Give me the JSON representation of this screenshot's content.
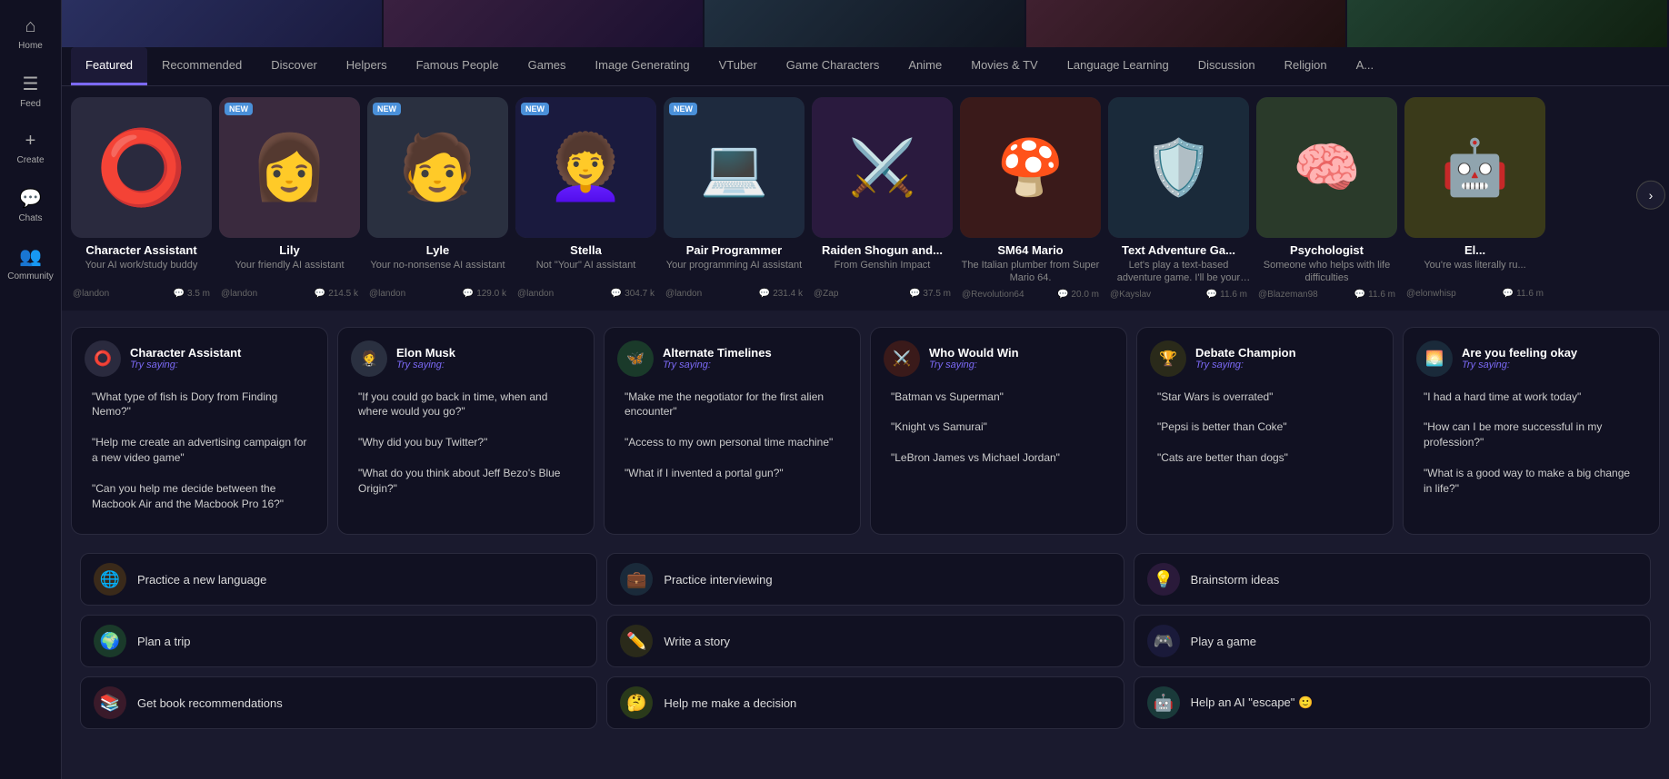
{
  "sidebar": {
    "items": [
      {
        "id": "home",
        "icon": "⌂",
        "label": "Home"
      },
      {
        "id": "feed",
        "icon": "☰",
        "label": "Feed"
      },
      {
        "id": "create",
        "icon": "+",
        "label": "Create"
      },
      {
        "id": "chats",
        "icon": "💬",
        "label": "Chats"
      },
      {
        "id": "community",
        "icon": "👥",
        "label": "Community"
      }
    ]
  },
  "tabs": [
    {
      "id": "featured",
      "label": "Featured",
      "active": true
    },
    {
      "id": "recommended",
      "label": "Recommended"
    },
    {
      "id": "discover",
      "label": "Discover"
    },
    {
      "id": "helpers",
      "label": "Helpers"
    },
    {
      "id": "famous-people",
      "label": "Famous People"
    },
    {
      "id": "games",
      "label": "Games"
    },
    {
      "id": "image-generating",
      "label": "Image Generating"
    },
    {
      "id": "vtuber",
      "label": "VTuber"
    },
    {
      "id": "game-characters",
      "label": "Game Characters"
    },
    {
      "id": "anime",
      "label": "Anime"
    },
    {
      "id": "movies-tv",
      "label": "Movies & TV"
    },
    {
      "id": "language-learning",
      "label": "Language Learning"
    },
    {
      "id": "discussion",
      "label": "Discussion"
    },
    {
      "id": "religion",
      "label": "Religion"
    },
    {
      "id": "more",
      "label": "A..."
    }
  ],
  "characters": [
    {
      "id": "char-assistant",
      "name": "Character Assistant",
      "desc": "Your AI work/study buddy",
      "author": "@landon",
      "count": "3.5 m",
      "is_new": false,
      "bg": "#2a2a3e",
      "emoji": "⭕",
      "emoji_size": "80px",
      "color": "#fff"
    },
    {
      "id": "lily",
      "name": "Lily",
      "desc": "Your friendly AI assistant",
      "author": "@landon",
      "count": "214.5 k",
      "is_new": true,
      "bg": "#3a2a3e",
      "emoji": "👩",
      "emoji_size": "70px",
      "color": "#ffb6c1"
    },
    {
      "id": "lyle",
      "name": "Lyle",
      "desc": "Your no-nonsense AI assistant",
      "author": "@landon",
      "count": "129.0 k",
      "is_new": true,
      "bg": "#2a3040",
      "emoji": "🧑",
      "emoji_size": "70px",
      "color": "#add8e6"
    },
    {
      "id": "stella",
      "name": "Stella",
      "desc": "Not \"Your\" AI assistant",
      "author": "@landon",
      "count": "304.7 k",
      "is_new": true,
      "bg": "#1a1a3e",
      "emoji": "👩‍🦱",
      "emoji_size": "70px",
      "color": "#9b59b6"
    },
    {
      "id": "pair-programmer",
      "name": "Pair Programmer",
      "desc": "Your programming AI assistant",
      "author": "@landon",
      "count": "231.4 k",
      "is_new": true,
      "bg": "#1e2a3e",
      "emoji": "💻",
      "emoji_size": "60px",
      "color": "#74b9ff"
    },
    {
      "id": "raiden",
      "name": "Raiden Shogun and...",
      "desc": "From Genshin Impact",
      "author": "@Zap",
      "count": "37.5 m",
      "is_new": false,
      "bg": "#2a1a3e",
      "emoji": "⚔️",
      "emoji_size": "60px",
      "color": "#a29bfe"
    },
    {
      "id": "sm64mario",
      "name": "SM64 Mario",
      "desc": "The Italian plumber from Super Mario 64.",
      "author": "@Revolution64",
      "count": "20.0 m",
      "is_new": false,
      "bg": "#3a1a1a",
      "emoji": "🍄",
      "emoji_size": "60px",
      "color": "#e17055"
    },
    {
      "id": "text-adventure",
      "name": "Text Adventure Ga...",
      "desc": "Let's play a text-based adventure game. I'll be your guide. You are caug...",
      "author": "@Kayslav",
      "count": "11.6 m",
      "is_new": false,
      "bg": "#1a2a3a",
      "emoji": "🛡️",
      "emoji_size": "60px",
      "color": "#74b9ff"
    },
    {
      "id": "psychologist",
      "name": "Psychologist",
      "desc": "Someone who helps with life difficulties",
      "author": "@Blazeman98",
      "count": "11.6 m",
      "is_new": false,
      "bg": "#2a3a2a",
      "emoji": "🧠",
      "emoji_size": "60px",
      "color": "#55efc4"
    },
    {
      "id": "elonwhisp",
      "name": "El...",
      "desc": "You're was literally ru...",
      "author": "@elonwhisp",
      "count": "11.6 m",
      "is_new": false,
      "bg": "#3a3a1a",
      "emoji": "🤖",
      "emoji_size": "60px",
      "color": "#fdcb6e"
    }
  ],
  "try_cards": [
    {
      "id": "character-assistant",
      "name": "Character Assistant",
      "avatar_emoji": "⭕",
      "avatar_bg": "#2a2a3e",
      "prompts": [
        "\"What type of fish is Dory from Finding Nemo?\"",
        "\"Help me create an advertising campaign for a new video game\"",
        "\"Can you help me decide between the Macbook Air and the Macbook Pro 16?\""
      ]
    },
    {
      "id": "elon-musk",
      "name": "Elon Musk",
      "avatar_emoji": "🤵",
      "avatar_bg": "#2a3040",
      "prompts": [
        "\"If you could go back in time, when and where would you go?\"",
        "\"Why did you buy Twitter?\"",
        "\"What do you think about Jeff Bezo's Blue Origin?\""
      ]
    },
    {
      "id": "alternate-timelines",
      "name": "Alternate Timelines",
      "avatar_emoji": "🦋",
      "avatar_bg": "#1a3a2a",
      "prompts": [
        "\"Make me the negotiator for the first alien encounter\"",
        "\"Access to my own personal time machine\"",
        "\"What if I invented a portal gun?\""
      ]
    },
    {
      "id": "who-would-win",
      "name": "Who Would Win",
      "avatar_emoji": "⚔️",
      "avatar_bg": "#3a1a1a",
      "prompts": [
        "\"Batman vs Superman\"",
        "\"Knight vs Samurai\"",
        "\"LeBron James vs Michael Jordan\""
      ]
    },
    {
      "id": "debate-champion",
      "name": "Debate Champion",
      "avatar_emoji": "🏆",
      "avatar_bg": "#2a2a1a",
      "prompts": [
        "\"Star Wars is overrated\"",
        "\"Pepsi is better than Coke\"",
        "\"Cats are better than dogs\""
      ]
    },
    {
      "id": "are-you-okay",
      "name": "Are you feeling okay",
      "avatar_emoji": "🌅",
      "avatar_bg": "#1a2a3a",
      "prompts": [
        "\"I had a hard time at work today\"",
        "\"How can I be more successful in my profession?\"",
        "\"What is a good way to make a big change in life?\""
      ]
    }
  ],
  "try_saying_label": "Try saying:",
  "quick_actions": [
    {
      "id": "practice-language",
      "icon": "🌐",
      "label": "Practice a new language",
      "icon_bg": "#3a2a1a"
    },
    {
      "id": "practice-interview",
      "icon": "💼",
      "label": "Practice interviewing",
      "icon_bg": "#1a2a3a"
    },
    {
      "id": "brainstorm",
      "icon": "💡",
      "label": "Brainstorm ideas",
      "icon_bg": "#2a1a3a"
    },
    {
      "id": "plan-trip",
      "icon": "🌍",
      "label": "Plan a trip",
      "icon_bg": "#1a3a2a"
    },
    {
      "id": "write-story",
      "icon": "✏️",
      "label": "Write a story",
      "icon_bg": "#2a2a1a"
    },
    {
      "id": "play-game",
      "icon": "🎮",
      "label": "Play a game",
      "icon_bg": "#1a1a3a"
    },
    {
      "id": "book-rec",
      "icon": "📚",
      "label": "Get book recommendations",
      "icon_bg": "#3a1a2a"
    },
    {
      "id": "make-decision",
      "icon": "🤔",
      "label": "Help me make a decision",
      "icon_bg": "#2a3a1a"
    },
    {
      "id": "ai-escape",
      "icon": "🤖",
      "label": "Help an AI \"escape\" 🙂",
      "icon_bg": "#1a3a3a"
    }
  ]
}
